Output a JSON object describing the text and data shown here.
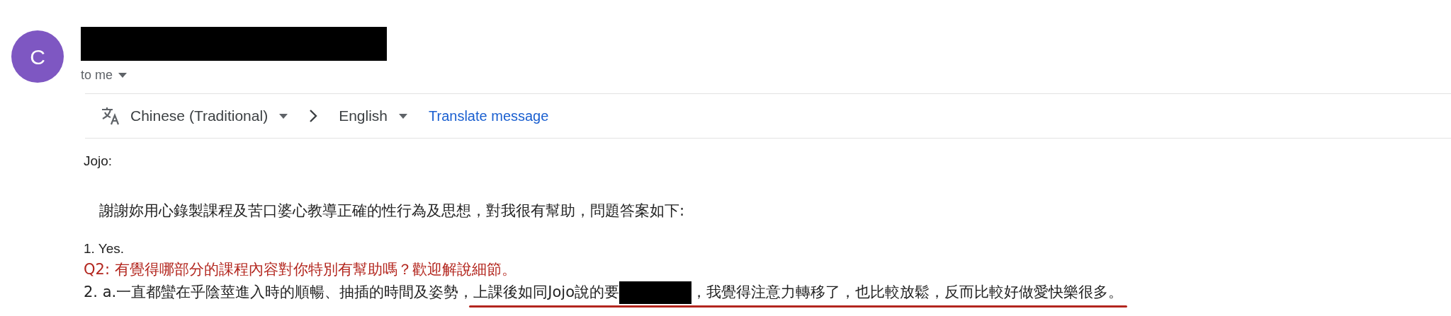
{
  "sender": {
    "avatar_letter": "C",
    "recipient_label": "to me"
  },
  "translate_bar": {
    "source_language": "Chinese (Traditional)",
    "target_language": "English",
    "action": "Translate message"
  },
  "body": {
    "greeting": "Jojo:",
    "intro": "謝謝妳用心錄製課程及苦口婆心教導正確的性行為及思想，對我很有幫助，問題答案如下:",
    "answer_1": "1. Yes.",
    "annotation": "Q2: 有覺得哪部分的課程內容對你特別有幫助嗎？歡迎解說細節。",
    "answer_2": {
      "lead": "2. a.一直都蠻在乎陰莖進入時的順暢、抽插的時間及姿勢，",
      "underlined_before": "上課後如同Jojo說的要",
      "underlined_after": "，我覺得注意力轉移了，也比較放鬆，反而比較好做愛快樂很多。"
    }
  }
}
